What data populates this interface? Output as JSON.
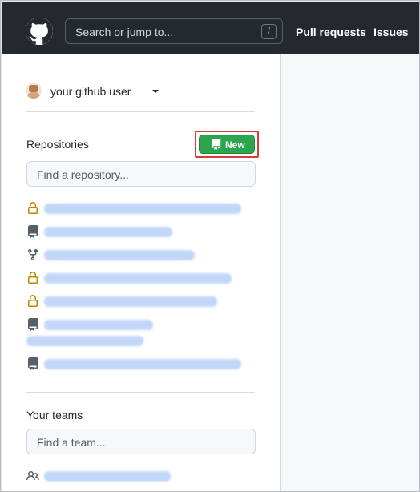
{
  "header": {
    "search_placeholder": "Search or jump to...",
    "search_shortcut": "/",
    "nav": [
      {
        "label": "Pull requests"
      },
      {
        "label": "Issues"
      }
    ]
  },
  "context": {
    "username": "your github user"
  },
  "repositories": {
    "title": "Repositories",
    "new_label": "New",
    "filter_placeholder": "Find a repository...",
    "items": [
      {
        "icon": "lock-icon"
      },
      {
        "icon": "repo-icon"
      },
      {
        "icon": "fork-icon"
      },
      {
        "icon": "lock-icon"
      },
      {
        "icon": "lock-icon"
      },
      {
        "icon": "repo-icon"
      },
      {
        "icon": "repo-icon"
      }
    ]
  },
  "teams": {
    "title": "Your teams",
    "filter_placeholder": "Find a team...",
    "items": [
      {
        "icon": "people-icon"
      }
    ]
  },
  "colors": {
    "header_bg": "#24292f",
    "new_button": "#2da44e",
    "highlight_outline": "#d93a3a",
    "lock_icon": "#bf8700"
  }
}
